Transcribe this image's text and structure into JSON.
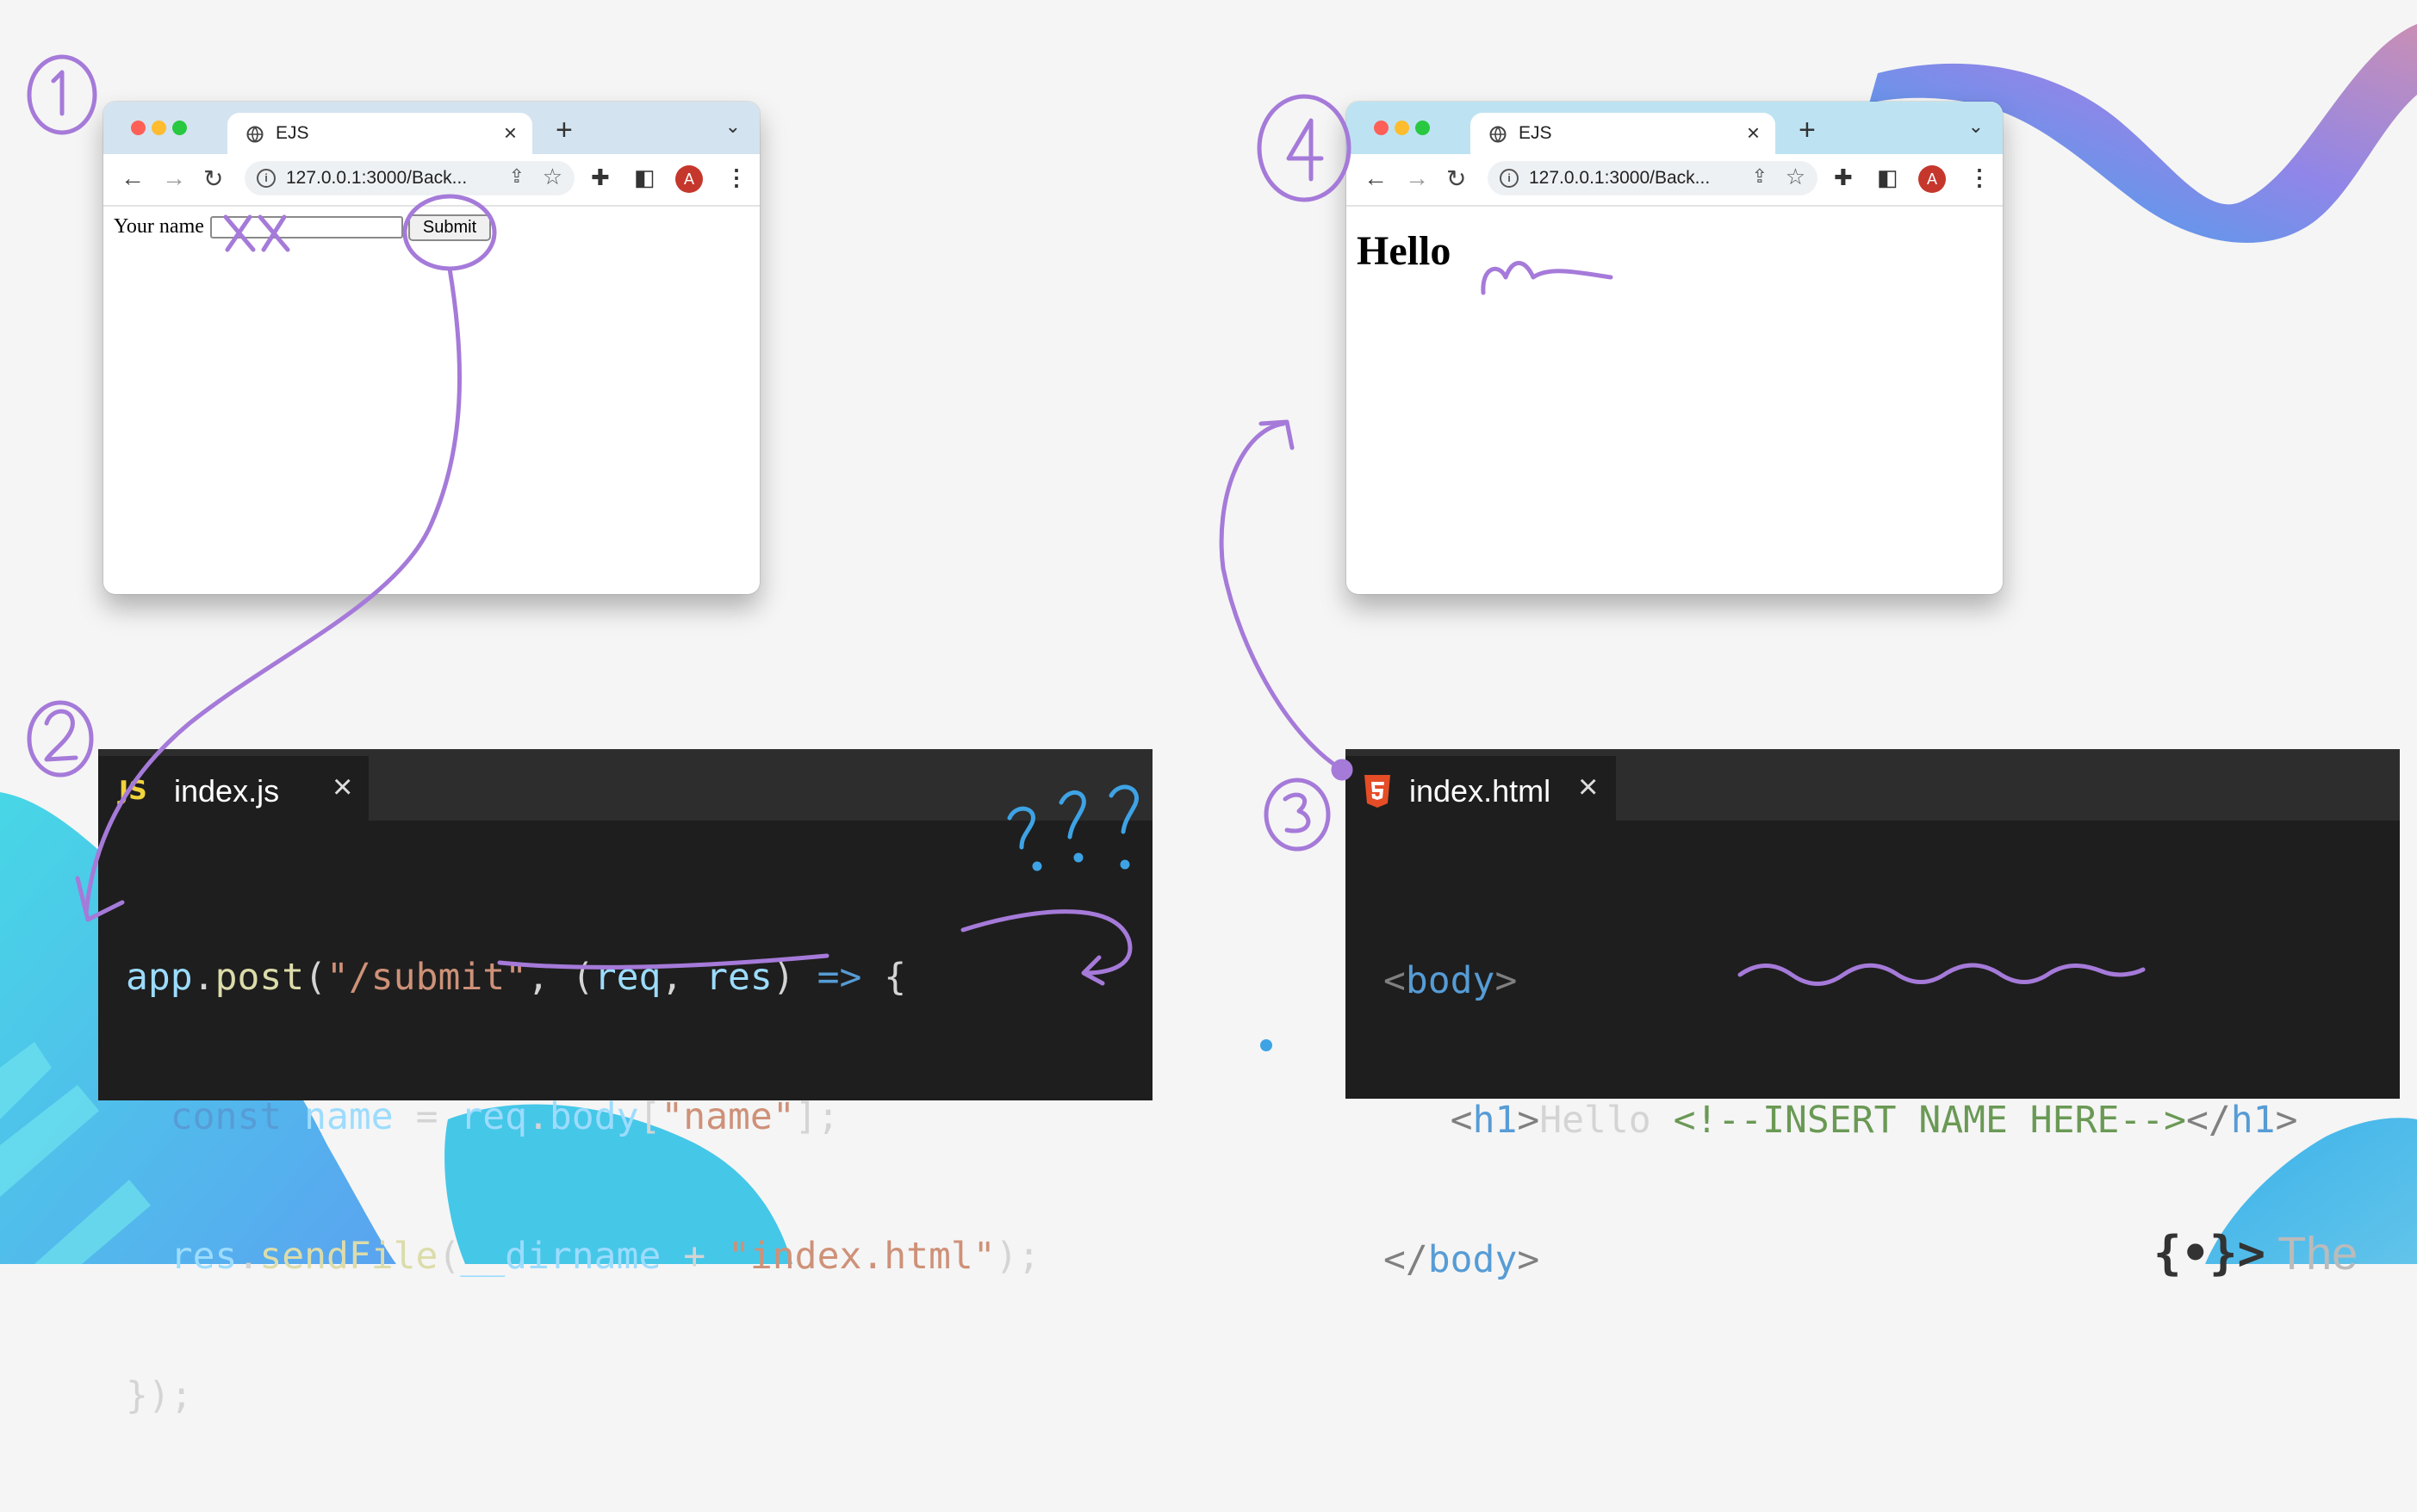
{
  "colors": {
    "background": "#f5f5f5",
    "annotation_purple": "#a57ad9",
    "annotation_blue": "#3ea3e5",
    "editor_bg": "#1e1e1e",
    "editor_tabbar": "#2d2d2d"
  },
  "browser_left": {
    "tab_title": "EJS",
    "url": "127.0.0.1:3000/Back...",
    "avatar_letter": "A",
    "form_label": "Your name",
    "submit_label": "Submit",
    "input_value": ""
  },
  "browser_right": {
    "tab_title": "EJS",
    "url": "127.0.0.1:3000/Back...",
    "avatar_letter": "A",
    "heading": "Hello"
  },
  "editor_js": {
    "filename": "index.js",
    "badge": "JS",
    "code": [
      "app.post(\"/submit\", (req, res) => {",
      "  const name = req.body[\"name\"];",
      "  res.sendFile(__dirname + \"index.html\");",
      "});"
    ]
  },
  "editor_html": {
    "filename": "index.html",
    "code": [
      "<body>",
      "   <h1>Hello <!--INSERT NAME HERE--></h1>",
      "</body>"
    ]
  },
  "annotations": {
    "step_1": "1",
    "step_2": "2",
    "step_3": "3",
    "step_4": "4",
    "question_marks": "???",
    "xx_mark": "XX"
  },
  "icons": [
    "globe-icon",
    "close-icon",
    "plus-icon",
    "chevron-down-icon",
    "back-arrow-icon",
    "forward-arrow-icon",
    "reload-icon",
    "info-icon",
    "share-icon",
    "star-icon",
    "extensions-icon",
    "sidepanel-icon",
    "kebab-menu-icon",
    "html5-icon"
  ],
  "footer_logo_text": "The"
}
